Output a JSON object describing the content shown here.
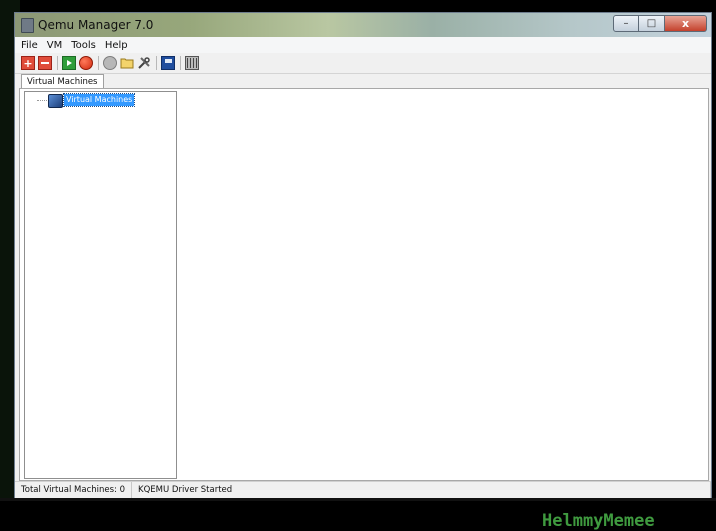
{
  "window": {
    "title": "Qemu Manager 7.0"
  },
  "window_controls": {
    "minimize": "–",
    "maximize": "□",
    "close": "x"
  },
  "menu": [
    "File",
    "VM",
    "Tools",
    "Help"
  ],
  "toolbar": {
    "add_symbol": "+",
    "icons": [
      "add-vm-icon",
      "remove-vm-icon",
      "start-vm-icon",
      "stop-vm-icon",
      "refresh-icon",
      "open-folder-icon",
      "tools-icon",
      "save-icon",
      "table-icon"
    ]
  },
  "tab": {
    "label": "Virtual Machines"
  },
  "tree": {
    "root_label": "Virtual Machines"
  },
  "watermark": "HelmmyMemee",
  "status": {
    "total_vms": "Total Virtual Machines: 0",
    "driver": "KQEMU Driver Started"
  },
  "colors": {
    "selection": "#3399ff",
    "watermark": "#3f9a3f"
  }
}
